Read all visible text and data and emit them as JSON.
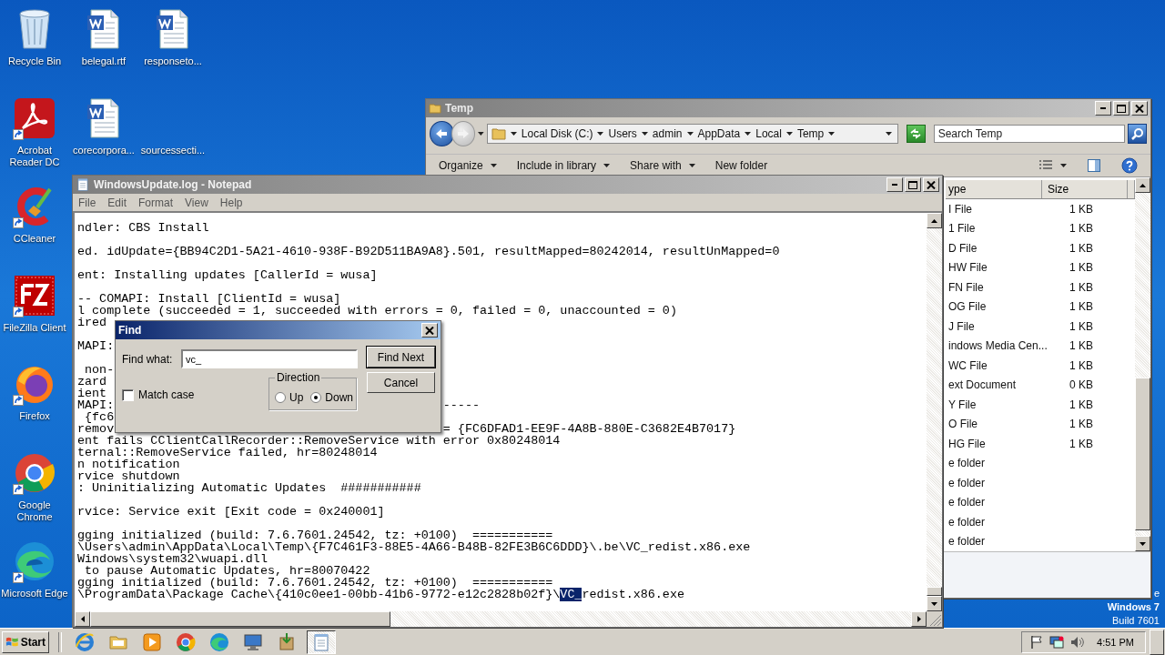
{
  "desktop": {
    "icon_columns": [
      {
        "icons": [
          {
            "label": "Recycle Bin",
            "kind": "recycle-bin",
            "shortcut": false
          },
          {
            "label": "Acrobat Reader DC",
            "kind": "pdf",
            "shortcut": true
          },
          {
            "label": "CCleaner",
            "kind": "ccleaner",
            "shortcut": true
          },
          {
            "label": "FileZilla Client",
            "kind": "filezilla",
            "shortcut": true
          },
          {
            "label": "Firefox",
            "kind": "firefox",
            "shortcut": true
          },
          {
            "label": "Google Chrome",
            "kind": "chrome",
            "shortcut": true
          },
          {
            "label": "Microsoft Edge",
            "kind": "edge",
            "shortcut": true
          }
        ]
      },
      {
        "icons": [
          {
            "label": "belegal.rtf",
            "kind": "word",
            "shortcut": false
          },
          {
            "label": "corecorpora...",
            "kind": "word",
            "shortcut": false
          }
        ]
      },
      {
        "icons": [
          {
            "label": "responseto...",
            "kind": "word",
            "shortcut": false
          },
          {
            "label": "sourcessecti...",
            "kind": "blank",
            "shortcut": false
          }
        ]
      }
    ],
    "os_text": [
      "e",
      "Windows 7",
      "Build 7601"
    ]
  },
  "explorer": {
    "title": "Temp",
    "breadcrumb": [
      "Local Disk (C:)",
      "Users",
      "admin",
      "AppData",
      "Local",
      "Temp"
    ],
    "search": {
      "placeholder": "Search Temp"
    },
    "toolbar": [
      {
        "label": "Organize",
        "dropdown": true
      },
      {
        "label": "Include in library",
        "dropdown": true
      },
      {
        "label": "Share with",
        "dropdown": true
      },
      {
        "label": "New folder",
        "dropdown": false
      }
    ],
    "columns": [
      "ype",
      "Size"
    ],
    "rows": [
      {
        "type": "I File",
        "size": "1 KB"
      },
      {
        "type": "1 File",
        "size": "1 KB"
      },
      {
        "type": "D File",
        "size": "1 KB"
      },
      {
        "type": "HW File",
        "size": "1 KB"
      },
      {
        "type": "FN File",
        "size": "1 KB"
      },
      {
        "type": "OG File",
        "size": "1 KB"
      },
      {
        "type": "J File",
        "size": "1 KB"
      },
      {
        "type": "indows Media Cen...",
        "size": "1 KB"
      },
      {
        "type": "WC File",
        "size": "1 KB"
      },
      {
        "type": "ext Document",
        "size": "0 KB"
      },
      {
        "type": "Y File",
        "size": "1 KB"
      },
      {
        "type": "O File",
        "size": "1 KB"
      },
      {
        "type": "HG File",
        "size": "1 KB"
      },
      {
        "type": "e folder"
      },
      {
        "type": "e folder"
      },
      {
        "type": "e folder"
      },
      {
        "type": "e folder"
      },
      {
        "type": "e folder"
      }
    ]
  },
  "notepad": {
    "title": "WindowsUpdate.log - Notepad",
    "menu": [
      "File",
      "Edit",
      "Format",
      "View",
      "Help"
    ],
    "lines": [
      {
        "kind": "text",
        "text": "ndler: CBS Install"
      },
      {
        "kind": "blank"
      },
      {
        "kind": "text",
        "text": "ed. idUpdate={BB94C2D1-5A21-4610-938F-B92D511BA9A8}.501, resultMapped=80242014, resultUnMapped=0"
      },
      {
        "kind": "blank"
      },
      {
        "kind": "text",
        "text": "ent: Installing updates [CallerId = wusa]"
      },
      {
        "kind": "blank"
      },
      {
        "kind": "text",
        "text": "-- COMAPI: Install [ClientId = wusa]"
      },
      {
        "kind": "text",
        "text": "l complete (succeeded = 1, succeeded with errors = 0, failed = 0, unaccounted = 0)"
      },
      {
        "kind": "text",
        "text": "ired"
      },
      {
        "kind": "blank"
      },
      {
        "kind": "text",
        "text": "MAPI:"
      },
      {
        "kind": "blank"
      },
      {
        "kind": "text",
        "text": " non-"
      },
      {
        "kind": "text",
        "text": "zard"
      },
      {
        "kind": "text",
        "text": "ient"
      },
      {
        "kind": "split",
        "text": "MAPI:",
        "right": "-----"
      },
      {
        "kind": "text",
        "text": " {fc6"
      },
      {
        "kind": "split",
        "text": "remov",
        "right": "= {FC6DFAD1-EE9F-4A8B-880E-C3682E4B7017}"
      },
      {
        "kind": "text",
        "text": "ent fails CClientCallRecorder::RemoveService with error 0x80248014"
      },
      {
        "kind": "text",
        "text": "ternal::RemoveService failed, hr=80248014"
      },
      {
        "kind": "text",
        "text": "n notification"
      },
      {
        "kind": "text",
        "text": "rvice shutdown"
      },
      {
        "kind": "text",
        "text": ": Uninitializing Automatic Updates  ###########"
      },
      {
        "kind": "blank"
      },
      {
        "kind": "text",
        "text": "rvice: Service exit [Exit code = 0x240001]"
      },
      {
        "kind": "blank"
      },
      {
        "kind": "text",
        "text": "gging initialized (build: 7.6.7601.24542, tz: +0100)  ==========="
      },
      {
        "kind": "text",
        "text": "\\Users\\admin\\AppData\\Local\\Temp\\{F7C461F3-88E5-4A66-B48B-82FE3B6C6DDD}\\.be\\VC_redist.x86.exe"
      },
      {
        "kind": "text",
        "text": "Windows\\system32\\wuapi.dll"
      },
      {
        "kind": "text",
        "text": " to pause Automatic Updates, hr=80070422"
      },
      {
        "kind": "text",
        "text": "gging initialized (build: 7.6.7601.24542, tz: +0100)  ==========="
      },
      {
        "kind": "match",
        "text": "\\ProgramData\\Package Cache\\{410c0ee1-00bb-41b6-9772-e12c2828b02f}\\",
        "selection": "VC_",
        "after": "redist.x86.exe"
      }
    ]
  },
  "find_dialog": {
    "title": "Find",
    "find_label": "Find what:",
    "find_value": "vc_",
    "match_case": {
      "label": "Match case",
      "checked": false
    },
    "direction": {
      "label": "Direction",
      "options": [
        {
          "label": "Up",
          "selected": false
        },
        {
          "label": "Down",
          "selected": true
        }
      ]
    },
    "buttons": [
      {
        "label": "Find Next",
        "default": true
      },
      {
        "label": "Cancel",
        "default": false
      }
    ]
  },
  "taskbar": {
    "start": "Start",
    "apps": [
      {
        "kind": "ie",
        "active": false
      },
      {
        "kind": "folder",
        "active": false
      },
      {
        "kind": "media",
        "active": false
      },
      {
        "kind": "chrome",
        "active": false
      },
      {
        "kind": "edge",
        "active": false
      },
      {
        "kind": "monitor",
        "active": false
      },
      {
        "kind": "installer",
        "active": false
      },
      {
        "kind": "notepad",
        "active": true
      }
    ],
    "clock": "4:51 PM"
  }
}
